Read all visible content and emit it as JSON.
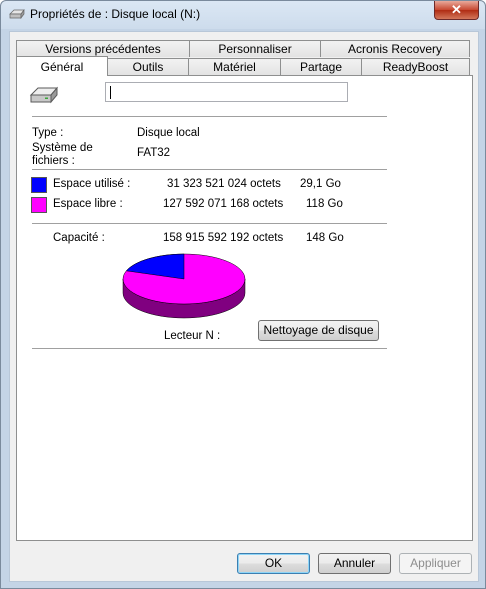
{
  "window": {
    "title": "Propriétés de : Disque local (N:)",
    "close_label": "✕"
  },
  "tabs_row1": [
    "Versions précédentes",
    "Personnaliser",
    "Acronis Recovery"
  ],
  "tabs_row2": [
    "Général",
    "Outils",
    "Matériel",
    "Partage",
    "ReadyBoost"
  ],
  "general": {
    "name_value": "",
    "type_label": "Type :",
    "type_value": "Disque local",
    "fs_label_1": "Système de",
    "fs_label_2": "fichiers :",
    "fs_value": "FAT32",
    "used_label": "Espace utilisé :",
    "used_bytes": "31 323 521 024 octets",
    "used_size": "29,1 Go",
    "free_label": "Espace libre :",
    "free_bytes": "127 592 071 168 octets",
    "free_size": "118 Go",
    "capacity_label": "Capacité :",
    "capacity_bytes": "158 915 592 192 octets",
    "capacity_size": "148 Go",
    "drive_label": "Lecteur N :",
    "cleanup_button": "Nettoyage de disque",
    "used_color": "#0000ff",
    "free_color": "#ff00ff",
    "free_side_color": "#800080",
    "used_side_color": "#000080"
  },
  "chart_data": {
    "type": "pie",
    "categories": [
      "Espace utilisé",
      "Espace libre"
    ],
    "values": [
      31323521024,
      127592071168
    ]
  },
  "buttons": {
    "ok": "OK",
    "cancel": "Annuler",
    "apply": "Appliquer"
  }
}
